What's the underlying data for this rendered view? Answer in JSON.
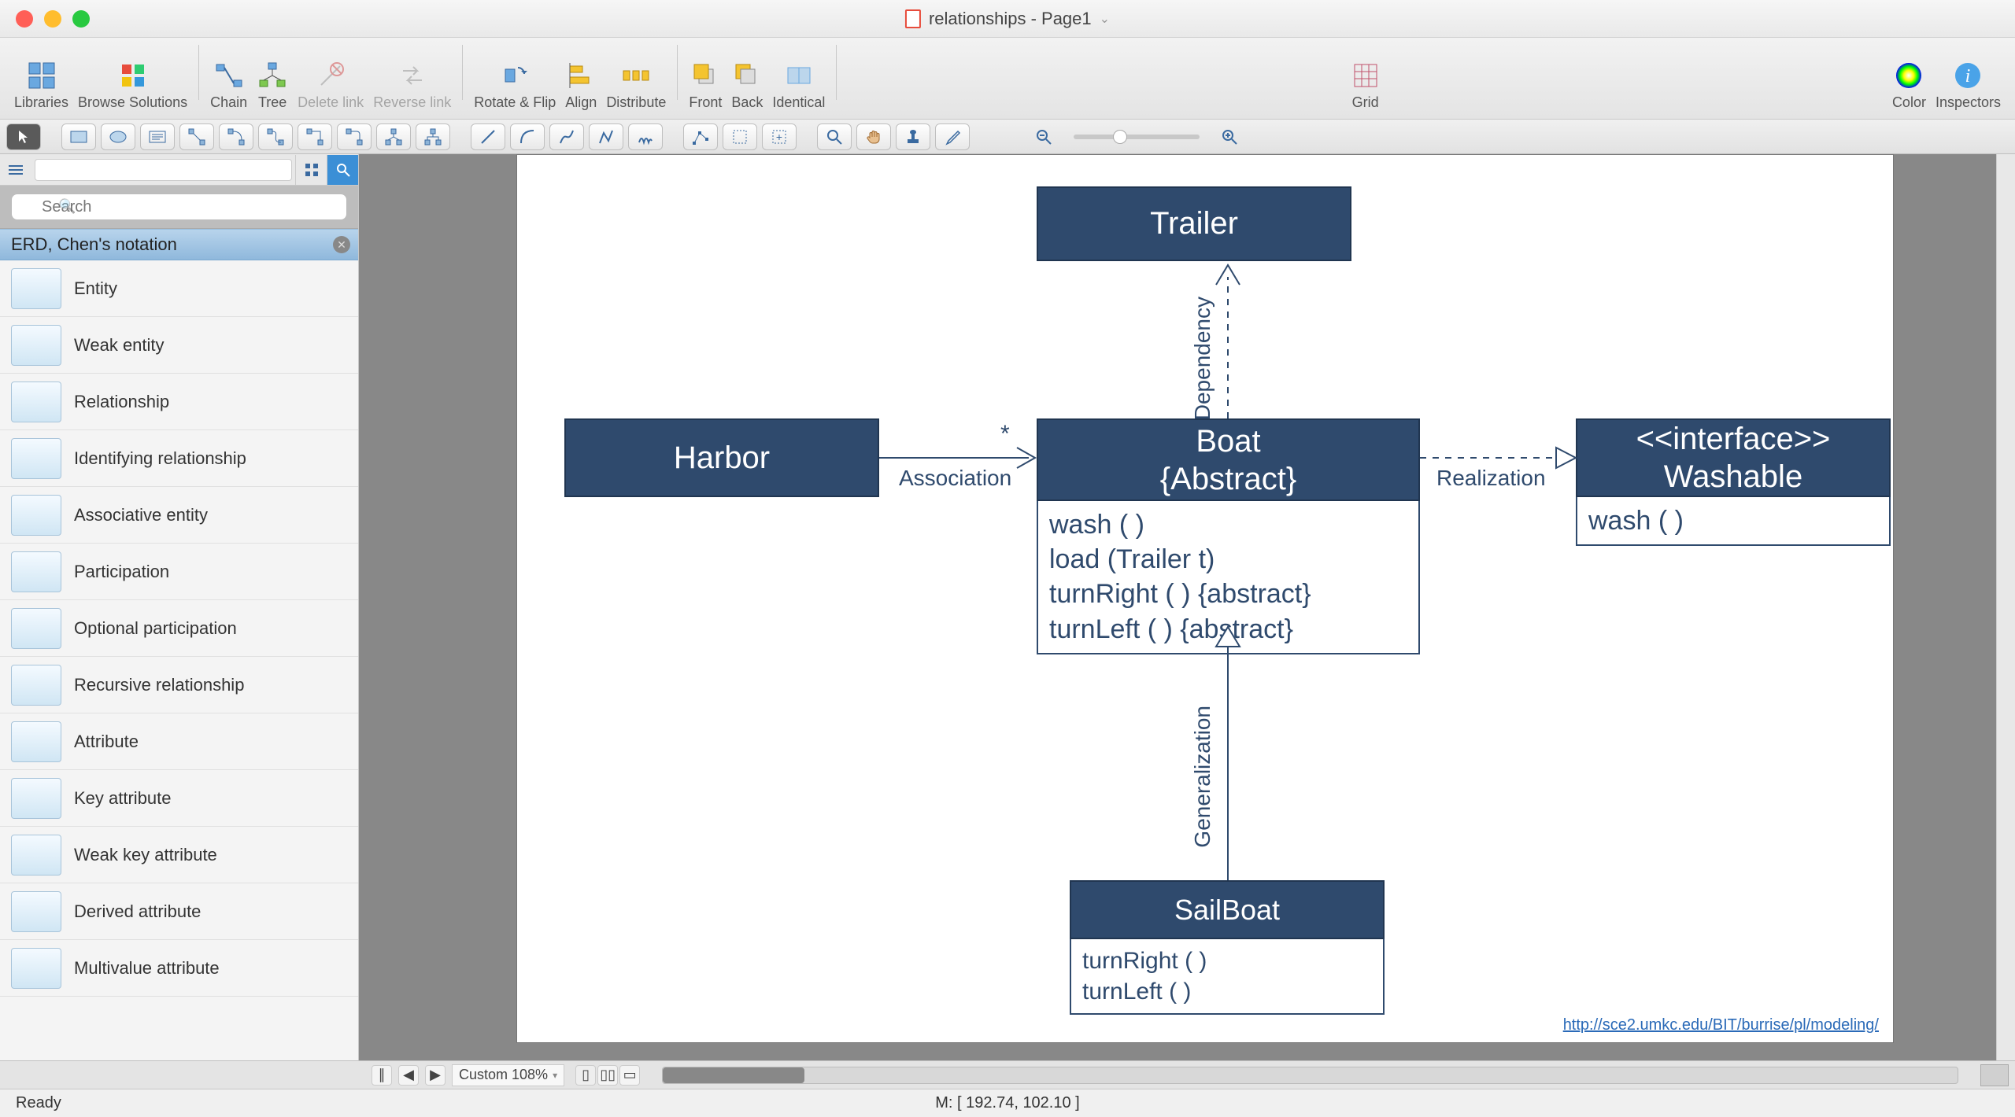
{
  "window": {
    "title": "relationships - Page1"
  },
  "toolbar": {
    "libraries": "Libraries",
    "browse": "Browse Solutions",
    "chain": "Chain",
    "tree": "Tree",
    "delete_link": "Delete link",
    "reverse_link": "Reverse link",
    "rotate_flip": "Rotate & Flip",
    "align": "Align",
    "distribute": "Distribute",
    "front": "Front",
    "back": "Back",
    "identical": "Identical",
    "grid": "Grid",
    "color": "Color",
    "inspectors": "Inspectors"
  },
  "sidebar": {
    "search_placeholder": "Search",
    "library_title": "ERD, Chen's notation",
    "shapes": [
      "Entity",
      "Weak entity",
      "Relationship",
      "Identifying relationship",
      "Associative entity",
      "Participation",
      "Optional participation",
      "Recursive relationship",
      "Attribute",
      "Key attribute",
      "Weak key attribute",
      "Derived attribute",
      "Multivalue attribute"
    ]
  },
  "diagram": {
    "trailer": "Trailer",
    "harbor": "Harbor",
    "boat_name": "Boat",
    "boat_stereo": "{Abstract}",
    "boat_ops": [
      "wash ( )",
      "load (Trailer t)",
      "turnRight ( ) {abstract}",
      "turnLeft ( ) {abstract}"
    ],
    "interface_stereo": "<<interface>>",
    "interface_name": "Washable",
    "interface_ops": [
      "wash ( )"
    ],
    "sailboat": "SailBoat",
    "sailboat_ops": [
      "turnRight ( )",
      "turnLeft ( )"
    ],
    "association": "Association",
    "mult": "*",
    "realization": "Realization",
    "dependency": "Dependency",
    "generalization": "Generalization",
    "url": "http://sce2.umkc.edu/BIT/burrise/pl/modeling/"
  },
  "footer": {
    "zoom": "Custom 108%",
    "status_left": "Ready",
    "status_mid": "M: [ 192.74, 102.10 ]"
  }
}
